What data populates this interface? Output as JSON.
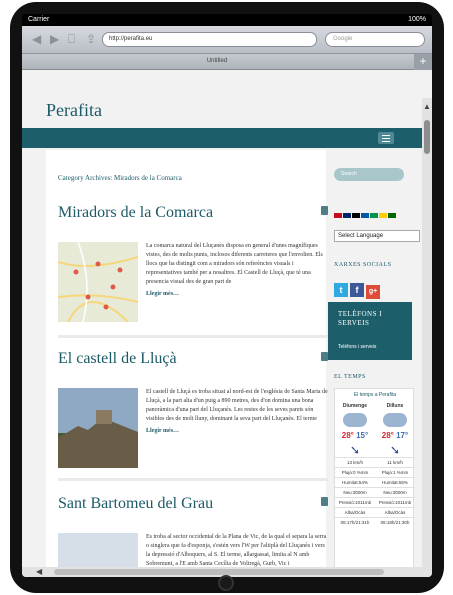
{
  "statusbar": {
    "carrier": "Carrier",
    "battery": "100%"
  },
  "browser": {
    "url": "http://perafita.eu",
    "search_placeholder": "Google",
    "tab_title": "Untitled",
    "add_tab": "+"
  },
  "site": {
    "title": "Perafita"
  },
  "archive": {
    "heading": "Category Archives: Miradors de la Comarca"
  },
  "posts": [
    {
      "title": "Miradors de la Comarca",
      "excerpt": "La comarca natural del Lluçanès disposa en general d'unes magnífiques vistes, des de molts punts, inclosos diferents carreteres que l'envolten. Els llocs que ha distingit com a miradors són referències visuals i representatives també per a nosaltres.     El Castell de Lluçà, que té una presencia visual des de gran part de",
      "more": "Llegir més…"
    },
    {
      "title": "El castell de Lluçà",
      "excerpt": "El castell de Lluçà es troba situat al nord-est de l'església de Santa Maria de Lluçà, a la part alta d'un puig a 890 metres, des d'on domina una bona panoràmica d'una part del Lluçanès. Les restes de les seves parets són visibles des de molt lluny, dominant la seva part del Lluçanès. El terme",
      "more": "Llegir més…"
    },
    {
      "title": "Sant Bartomeu del Grau",
      "excerpt": "Es troba al sector occidental de la Plana de Vic, de la qual el separa la serra o singlera que fa d'esponja, s'estén vers l'W per l'altiplà del Lluçanès i vers la depressió d'Alboquers, al S. El terme, allargassat, limita al N amb Sobremunt, a l'E amb Santa Cecília de Voltregà, Gurb, Vic i",
      "more": ""
    }
  ],
  "sidebar": {
    "search_placeholder": "Search",
    "language_select": "Select Language",
    "social_heading": "XARXES SOCIALS",
    "social": [
      "t",
      "f",
      "g+"
    ],
    "tel_title": "TELÈFONS I SERVEIS",
    "tel_sub": "Telèfons i serveis",
    "weather_heading": "EL TEMPS",
    "weather": {
      "link": "El temps a Perafita",
      "days": [
        {
          "day": "Diumenge",
          "hi": "28°",
          "lo": "15°",
          "wind": "13 km/h",
          "rain": "Pluja:0 %mm",
          "humidity": "Humitat:54%",
          "snow": "Neu:3000m",
          "pressure": "Pressió:1011mb",
          "sunrise_label": "Alba/Ocàs",
          "sunrise": "06:17h/21:31h"
        },
        {
          "day": "Dilluns",
          "hi": "28°",
          "lo": "17°",
          "wind": "11 km/h",
          "rain": "Pluja:1 %mm",
          "humidity": "Humitat:65%",
          "snow": "Neu:3000m",
          "pressure": "Pressió:1011mb",
          "sunrise_label": "Alba/Ocàs",
          "sunrise": "06:18h/21:30h"
        }
      ]
    }
  },
  "colors": {
    "brand": "#1c5f6b",
    "hi": "#d8262d",
    "lo": "#3b6fb0"
  }
}
